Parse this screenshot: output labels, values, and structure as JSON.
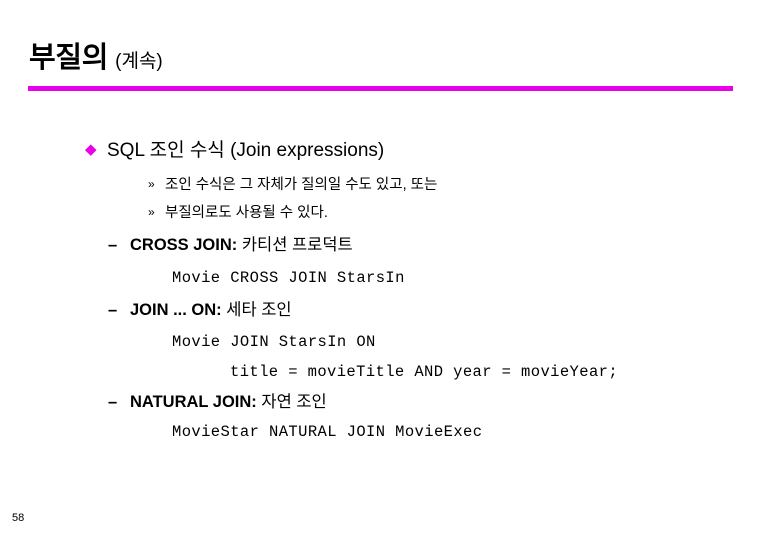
{
  "slide": {
    "title": {
      "main": "부질의",
      "sub": "(계속)",
      "rule_color": "#e800e8"
    },
    "page_number": "58",
    "bullet_glyphs": {
      "diamond": "◆",
      "double_angle": "»",
      "dash": "–"
    },
    "content": [
      {
        "level": 1,
        "marker": "◆",
        "text": "SQL 조인 수식 (Join expressions)"
      },
      {
        "level": 3,
        "marker": "»",
        "text": "조인 수식은 그 자체가 질의일 수도 있고, 또는"
      },
      {
        "level": 3,
        "marker": "»",
        "text": "부질의로도 사용될 수 있다."
      },
      {
        "level": 2,
        "marker": "–",
        "label": "CROSS JOIN:",
        "korean": "카티션 프로덕트"
      },
      {
        "level": "code",
        "text": "Movie CROSS JOIN StarsIn"
      },
      {
        "level": 2,
        "marker": "–",
        "label": "JOIN ... ON:",
        "korean": "세타 조인"
      },
      {
        "level": "code",
        "text": "Movie JOIN StarsIn ON"
      },
      {
        "level": "code",
        "text": "title = movieTitle AND year = movieYear;"
      },
      {
        "level": 2,
        "marker": "–",
        "label": "NATURAL JOIN:",
        "korean": "자연 조인"
      },
      {
        "level": "code",
        "text": "MovieStar NATURAL JOIN MovieExec"
      }
    ]
  }
}
